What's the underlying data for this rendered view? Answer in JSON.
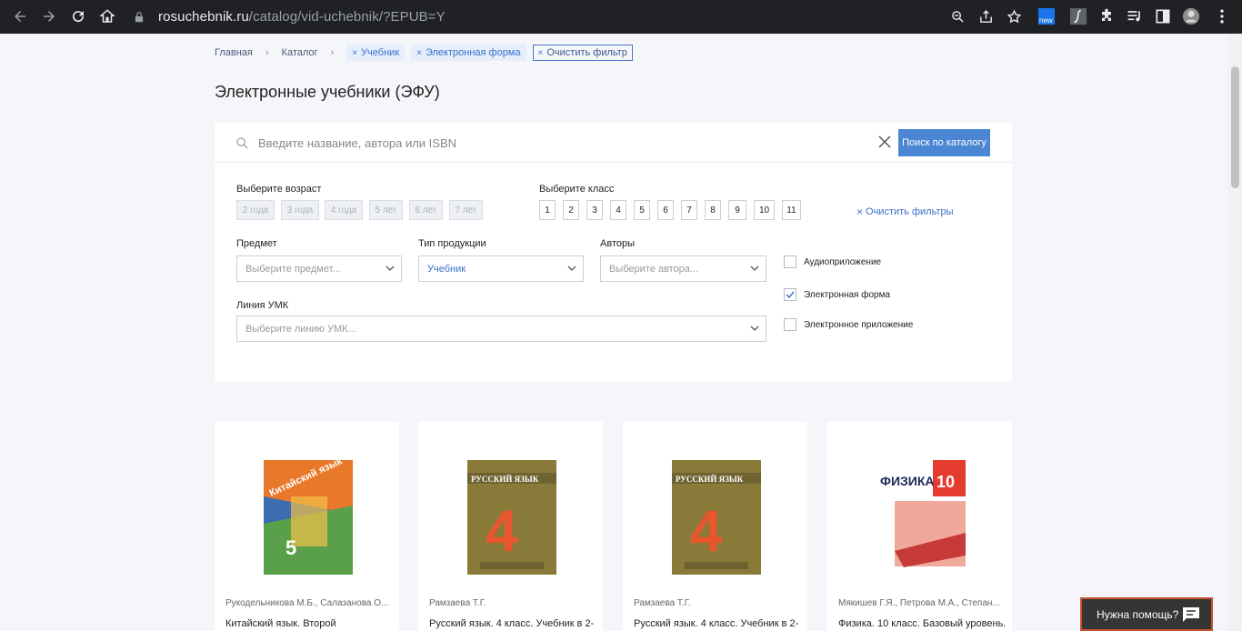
{
  "browser": {
    "url_domain": "rosuchebnik.ru",
    "url_path": "/catalog/vid-uchebnik/?EPUB=Y",
    "ext_badge": "new"
  },
  "breadcrumbs": {
    "home": "Главная",
    "catalog": "Каталог",
    "chips": [
      "Учебник",
      "Электронная форма"
    ],
    "clear_chip": "Очистить фильтр"
  },
  "title": "Электронные учебники (ЭФУ)",
  "search": {
    "placeholder": "Введите название, автора или ISBN",
    "button": "Поиск по каталогу"
  },
  "filters": {
    "age_label": "Выберите возраст",
    "ages": [
      "2 года",
      "3 года",
      "4 года",
      "5 лет",
      "6 лет",
      "7 лет"
    ],
    "grade_label": "Выберите класс",
    "grades": [
      "1",
      "2",
      "3",
      "4",
      "5",
      "6",
      "7",
      "8",
      "9",
      "10",
      "11"
    ],
    "clear_filters": "Очистить фильтры",
    "subject_label": "Предмет",
    "subject_placeholder": "Выберите предмет...",
    "product_type_label": "Тип продукции",
    "product_type_value": "Учебник",
    "authors_label": "Авторы",
    "authors_placeholder": "Выберите автора...",
    "umk_label": "Линия УМК",
    "umk_placeholder": "Выберите линию УМК...",
    "checks": [
      {
        "label": "Аудиоприложение",
        "checked": false
      },
      {
        "label": "Электронная форма",
        "checked": true
      },
      {
        "label": "Электронное приложение",
        "checked": false
      }
    ]
  },
  "cards": [
    {
      "author": "Рукодельникова М.Б., Салазанова О...",
      "title": "Китайский язык. Второй",
      "cover_title": "Китайский язык",
      "cover_num": "5",
      "cover_color": "#3b6db0"
    },
    {
      "author": "Рамзаева Т.Г.",
      "title": "Русский язык. 4 класс. Учебник в 2-",
      "cover_title": "РУССКИЙ ЯЗЫК",
      "cover_num": "4",
      "cover_color": "#8a7a3a"
    },
    {
      "author": "Рамзаева Т.Г.",
      "title": "Русский язык. 4 класс. Учебник в 2-",
      "cover_title": "РУССКИЙ ЯЗЫК",
      "cover_num": "4",
      "cover_color": "#8a7a3a"
    },
    {
      "author": "Мякишев Г.Я., Петрова М.А., Степан...",
      "title": "Физика. 10 класс. Базовый уровень.",
      "cover_title": "ФИЗИКА",
      "cover_num": "10",
      "cover_color": "#e53a2e"
    }
  ],
  "help": {
    "label": "Нужна помощь?"
  }
}
